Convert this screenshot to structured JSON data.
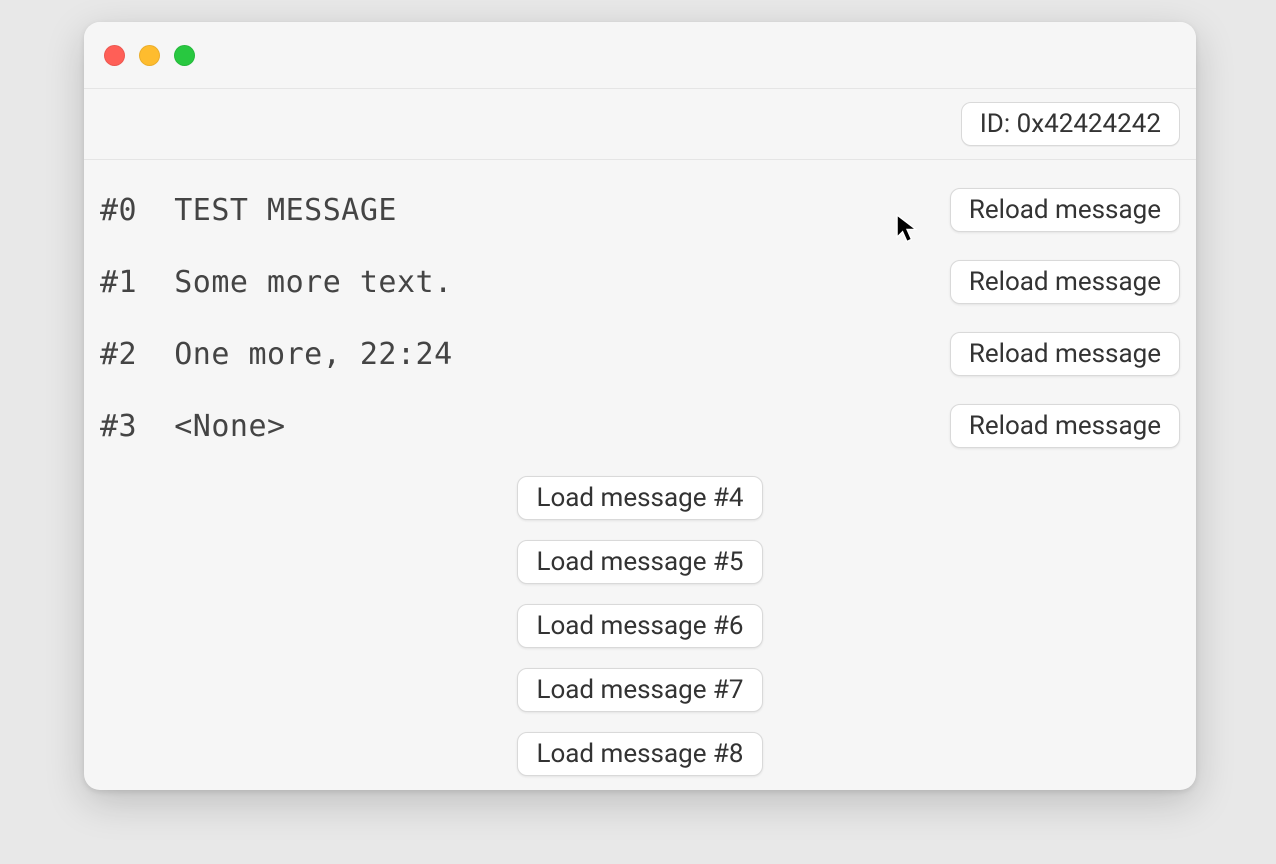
{
  "toolbar": {
    "id_label": "ID: 0x42424242"
  },
  "messages": [
    {
      "index": "#0",
      "text": "TEST MESSAGE",
      "reload_label": "Reload message"
    },
    {
      "index": "#1",
      "text": "Some more text.",
      "reload_label": "Reload message"
    },
    {
      "index": "#2",
      "text": "One more, 22:24",
      "reload_label": "Reload message"
    },
    {
      "index": "#3",
      "text": "<None>",
      "reload_label": "Reload message"
    }
  ],
  "load_buttons": [
    {
      "label": "Load message #4"
    },
    {
      "label": "Load message #5"
    },
    {
      "label": "Load message #6"
    },
    {
      "label": "Load message #7"
    },
    {
      "label": "Load message #8"
    }
  ]
}
